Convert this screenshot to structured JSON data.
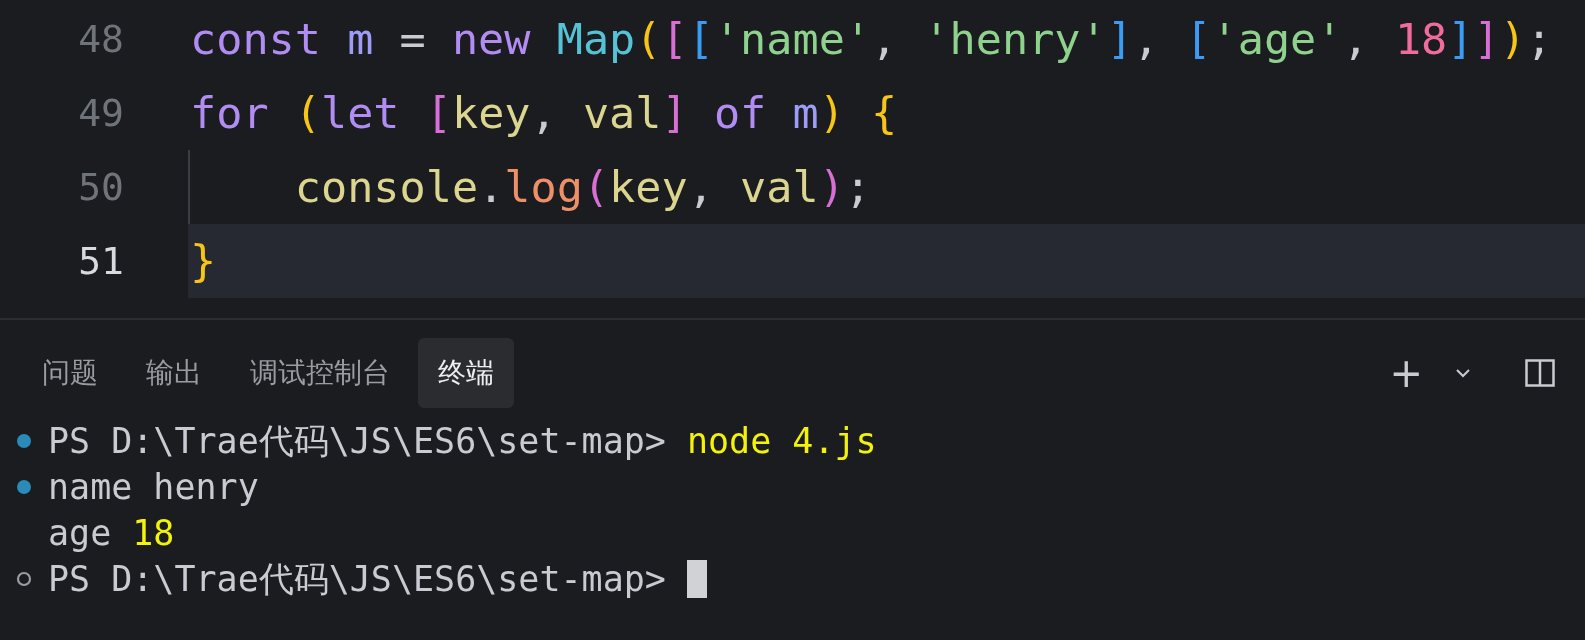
{
  "editor": {
    "lines": [
      {
        "number": "48",
        "current": false,
        "indent_guide": false,
        "tokens": [
          {
            "text": "const ",
            "kind": "keyword"
          },
          {
            "text": "m",
            "kind": "variable"
          },
          {
            "text": " = ",
            "kind": "plain"
          },
          {
            "text": "new ",
            "kind": "keyword"
          },
          {
            "text": "Map",
            "kind": "class"
          },
          {
            "text": "(",
            "kind": "bracket1"
          },
          {
            "text": "[",
            "kind": "bracket2"
          },
          {
            "text": "[",
            "kind": "bracket3"
          },
          {
            "text": "'name'",
            "kind": "string"
          },
          {
            "text": ", ",
            "kind": "plain"
          },
          {
            "text": "'henry'",
            "kind": "string"
          },
          {
            "text": "]",
            "kind": "bracket3"
          },
          {
            "text": ", ",
            "kind": "plain"
          },
          {
            "text": "[",
            "kind": "bracket3"
          },
          {
            "text": "'age'",
            "kind": "string"
          },
          {
            "text": ", ",
            "kind": "plain"
          },
          {
            "text": "18",
            "kind": "number"
          },
          {
            "text": "]",
            "kind": "bracket3"
          },
          {
            "text": "]",
            "kind": "bracket2"
          },
          {
            "text": ")",
            "kind": "bracket1"
          },
          {
            "text": ";",
            "kind": "plain"
          }
        ]
      },
      {
        "number": "49",
        "current": false,
        "indent_guide": false,
        "tokens": [
          {
            "text": "for ",
            "kind": "keyword"
          },
          {
            "text": "(",
            "kind": "bracket1"
          },
          {
            "text": "let ",
            "kind": "keyword"
          },
          {
            "text": "[",
            "kind": "bracket2"
          },
          {
            "text": "key",
            "kind": "param"
          },
          {
            "text": ", ",
            "kind": "plain"
          },
          {
            "text": "val",
            "kind": "param"
          },
          {
            "text": "] ",
            "kind": "bracket2"
          },
          {
            "text": "of ",
            "kind": "keyword"
          },
          {
            "text": "m",
            "kind": "variable"
          },
          {
            "text": ") ",
            "kind": "bracket1"
          },
          {
            "text": "{",
            "kind": "bracket1"
          }
        ]
      },
      {
        "number": "50",
        "current": false,
        "indent_guide": true,
        "tokens": [
          {
            "text": "    console",
            "kind": "param"
          },
          {
            "text": ".",
            "kind": "plain"
          },
          {
            "text": "log",
            "kind": "function"
          },
          {
            "text": "(",
            "kind": "bracket2"
          },
          {
            "text": "key",
            "kind": "param"
          },
          {
            "text": ", ",
            "kind": "plain"
          },
          {
            "text": "val",
            "kind": "param"
          },
          {
            "text": ")",
            "kind": "bracket2"
          },
          {
            "text": ";",
            "kind": "plain"
          }
        ]
      },
      {
        "number": "51",
        "current": true,
        "indent_guide": false,
        "tokens": [
          {
            "text": "}",
            "kind": "bracket1"
          }
        ]
      }
    ]
  },
  "panel": {
    "tabs": [
      {
        "label": "问题",
        "selected": false
      },
      {
        "label": "输出",
        "selected": false
      },
      {
        "label": "调试控制台",
        "selected": false
      },
      {
        "label": "终端",
        "selected": true
      }
    ],
    "actions": [
      {
        "text": "+",
        "kind": "new-terminal"
      },
      {
        "kind": "dropdown"
      },
      {
        "kind": "split"
      }
    ]
  },
  "terminal": {
    "lines": [
      {
        "kind": "success",
        "tokens": [
          {
            "text": "PS D:\\Trae代码\\JS\\ES6\\set-map> ",
            "kind": "plain"
          },
          {
            "text": "node 4.js",
            "kind": "highlight"
          }
        ]
      },
      {
        "kind": "success",
        "tokens": [
          {
            "text": "name henry",
            "kind": "plain"
          }
        ]
      },
      {
        "kind": "continuation",
        "tokens": [
          {
            "text": "age ",
            "kind": "plain"
          },
          {
            "text": "18",
            "kind": "highlight"
          }
        ]
      },
      {
        "kind": "prompt",
        "cursor": true,
        "tokens": [
          {
            "text": "PS D:\\Trae代码\\JS\\ES6\\set-map> ",
            "kind": "plain"
          }
        ]
      }
    ]
  }
}
